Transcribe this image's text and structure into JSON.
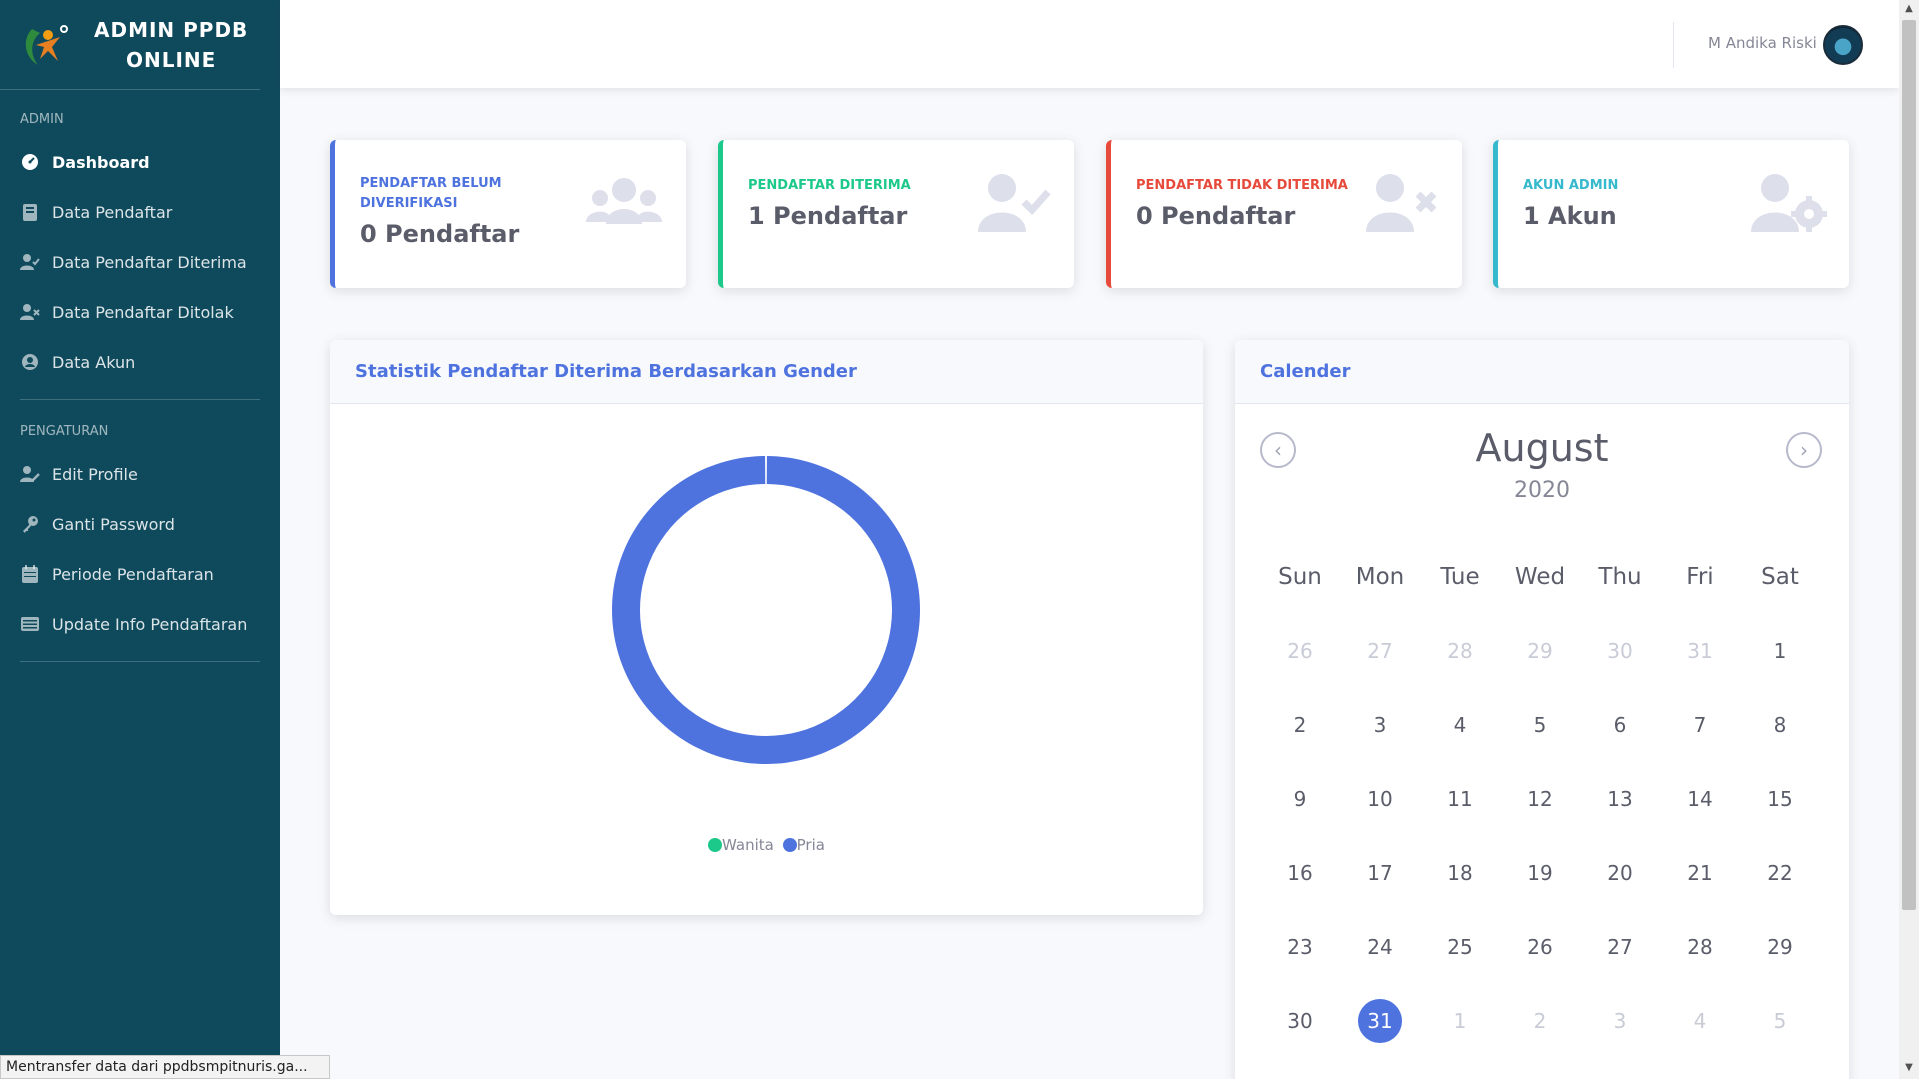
{
  "sidebar": {
    "brand_line1": "ADMIN PPDB",
    "brand_line2": "ONLINE",
    "heading_admin": "ADMIN",
    "heading_settings": "PENGATURAN",
    "items_admin": [
      {
        "label": "Dashboard",
        "icon": "tachometer-icon"
      },
      {
        "label": "Data Pendaftar",
        "icon": "book-icon"
      },
      {
        "label": "Data Pendaftar Diterima",
        "icon": "user-check-icon"
      },
      {
        "label": "Data Pendaftar Ditolak",
        "icon": "user-times-icon"
      },
      {
        "label": "Data Akun",
        "icon": "user-circle-icon"
      }
    ],
    "items_settings": [
      {
        "label": "Edit Profile",
        "icon": "user-edit-icon"
      },
      {
        "label": "Ganti Password",
        "icon": "key-icon"
      },
      {
        "label": "Periode Pendaftaran",
        "icon": "calendar-icon"
      },
      {
        "label": "Update Info Pendaftaran",
        "icon": "list-icon"
      }
    ]
  },
  "topbar": {
    "username": "M Andika Riski"
  },
  "stats": [
    {
      "label": "PENDAFTAR BELUM DIVERIFIKASI",
      "value": "0 Pendaftar",
      "color": "#4e73df",
      "icon": "users-icon"
    },
    {
      "label": "PENDAFTAR DITERIMA",
      "value": "1 Pendaftar",
      "color": "#1cc88a",
      "icon": "user-check-icon"
    },
    {
      "label": "PENDAFTAR TIDAK DITERIMA",
      "value": "0 Pendaftar",
      "color": "#e74a3b",
      "icon": "user-times-icon"
    },
    {
      "label": "AKUN ADMIN",
      "value": "1 Akun",
      "color": "#36b9cc",
      "icon": "user-cog-icon"
    }
  ],
  "chart_card": {
    "title": "Statistik Pendaftar Diterima Berdasarkan Gender"
  },
  "chart_data": {
    "type": "pie",
    "categories": [
      "Wanita",
      "Pria"
    ],
    "values": [
      0,
      1
    ],
    "colors": [
      "#1cc88a",
      "#4e73df"
    ],
    "legend_position": "bottom"
  },
  "calendar": {
    "title": "Calender",
    "month": "August",
    "year": "2020",
    "weekdays": [
      "Sun",
      "Mon",
      "Tue",
      "Wed",
      "Thu",
      "Fri",
      "Sat"
    ],
    "weeks": [
      [
        {
          "d": "26",
          "dim": true
        },
        {
          "d": "27",
          "dim": true
        },
        {
          "d": "28",
          "dim": true
        },
        {
          "d": "29",
          "dim": true
        },
        {
          "d": "30",
          "dim": true
        },
        {
          "d": "31",
          "dim": true
        },
        {
          "d": "1"
        }
      ],
      [
        {
          "d": "2"
        },
        {
          "d": "3"
        },
        {
          "d": "4"
        },
        {
          "d": "5"
        },
        {
          "d": "6"
        },
        {
          "d": "7"
        },
        {
          "d": "8"
        }
      ],
      [
        {
          "d": "9"
        },
        {
          "d": "10"
        },
        {
          "d": "11"
        },
        {
          "d": "12"
        },
        {
          "d": "13"
        },
        {
          "d": "14"
        },
        {
          "d": "15"
        }
      ],
      [
        {
          "d": "16"
        },
        {
          "d": "17"
        },
        {
          "d": "18"
        },
        {
          "d": "19"
        },
        {
          "d": "20"
        },
        {
          "d": "21"
        },
        {
          "d": "22"
        }
      ],
      [
        {
          "d": "23"
        },
        {
          "d": "24"
        },
        {
          "d": "25"
        },
        {
          "d": "26"
        },
        {
          "d": "27"
        },
        {
          "d": "28"
        },
        {
          "d": "29"
        }
      ],
      [
        {
          "d": "30"
        },
        {
          "d": "31",
          "today": true
        },
        {
          "d": "1",
          "dim": true
        },
        {
          "d": "2",
          "dim": true
        },
        {
          "d": "3",
          "dim": true
        },
        {
          "d": "4",
          "dim": true
        },
        {
          "d": "5",
          "dim": true
        }
      ]
    ]
  },
  "statusbar": {
    "text": "Mentransfer data dari ppdbsmpitnuris.ga..."
  }
}
